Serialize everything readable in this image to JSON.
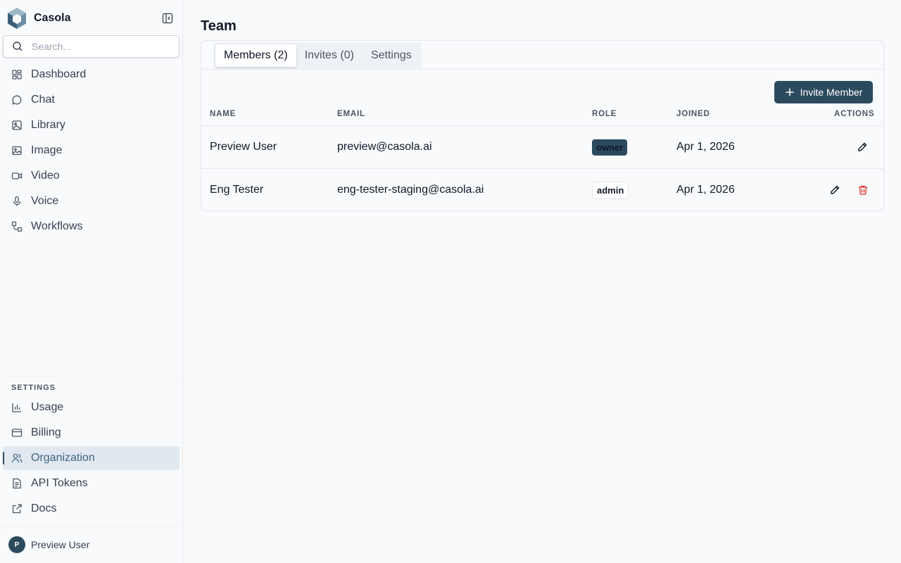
{
  "app": {
    "name": "Casola"
  },
  "sidebar": {
    "search_placeholder": "Search...",
    "main_items": [
      {
        "label": "Dashboard",
        "icon": "dashboard-icon"
      },
      {
        "label": "Chat",
        "icon": "chat-icon"
      },
      {
        "label": "Library",
        "icon": "library-icon"
      },
      {
        "label": "Image",
        "icon": "image-icon"
      },
      {
        "label": "Video",
        "icon": "video-icon"
      },
      {
        "label": "Voice",
        "icon": "microphone-icon"
      },
      {
        "label": "Workflows",
        "icon": "workflow-icon"
      }
    ],
    "settings_heading": "SETTINGS",
    "settings_items": [
      {
        "label": "Usage",
        "icon": "bar-chart-icon"
      },
      {
        "label": "Billing",
        "icon": "credit-card-icon"
      },
      {
        "label": "Organization",
        "icon": "users-icon",
        "active": true
      },
      {
        "label": "API Tokens",
        "icon": "document-icon"
      },
      {
        "label": "Docs",
        "icon": "external-link-icon"
      }
    ],
    "user": {
      "initial": "P",
      "name": "Preview User"
    }
  },
  "main": {
    "title": "Team",
    "tabs": [
      {
        "label": "Members (2)",
        "active": true
      },
      {
        "label": "Invites (0)"
      },
      {
        "label": "Settings"
      }
    ],
    "invite_label": "Invite Member",
    "columns": {
      "name": "NAME",
      "email": "EMAIL",
      "role": "ROLE",
      "joined": "JOINED",
      "actions": "ACTIONS"
    },
    "members": [
      {
        "name": "Preview User",
        "email": "preview@casola.ai",
        "role": "owner",
        "joined": "Apr 1, 2026",
        "actions": [
          "edit"
        ]
      },
      {
        "name": "Eng Tester",
        "email": "eng-tester-staging@casola.ai",
        "role": "admin",
        "joined": "Apr 1, 2026",
        "actions": [
          "edit",
          "delete"
        ]
      }
    ]
  },
  "colors": {
    "accent": "#2c4a5e",
    "active_nav_bg": "#e2e8f0",
    "danger": "#dc2626"
  }
}
